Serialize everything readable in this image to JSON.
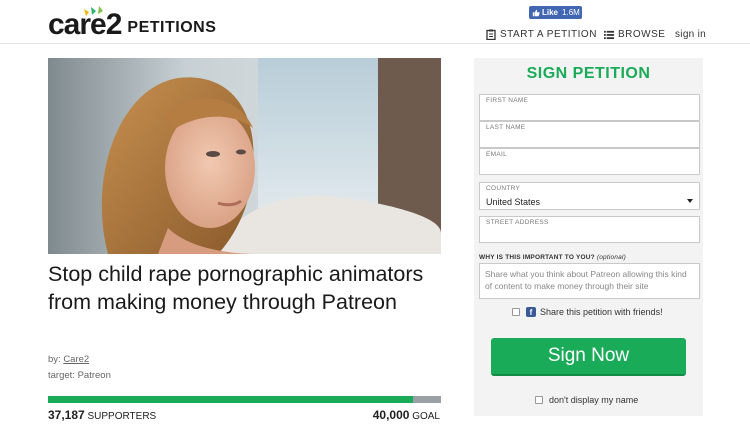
{
  "header": {
    "logo_main": "care2",
    "logo_sub": "PETITIONS",
    "fb_like_label": "Like",
    "fb_like_count": "1.6M",
    "nav": {
      "start_label": "START A PETITION",
      "browse_label": "BROWSE",
      "signin_label": "sign in"
    }
  },
  "petition": {
    "title": "Stop child rape pornographic animators from making money through Patreon",
    "by_prefix": "by: ",
    "author": "Care2",
    "target_prefix": "target: ",
    "target": "Patreon",
    "supporters_count": "37,187",
    "supporters_label": "SUPPORTERS",
    "goal_count": "40,000",
    "goal_label": "GOAL",
    "progress_fraction": 0.93
  },
  "form": {
    "title": "SIGN PETITION",
    "first_name_label": "FIRST NAME",
    "last_name_label": "LAST NAME",
    "email_label": "EMAIL",
    "country_label": "COUNTRY",
    "country_value": "United States",
    "street_label": "STREET ADDRESS",
    "why_label": "WHY IS THIS IMPORTANT TO YOU?",
    "why_optional": "(optional)",
    "why_placeholder": "Share what you think about Patreon allowing this kind of content to make money through their site",
    "share_label": "Share this petition with friends!",
    "sign_button": "Sign Now",
    "hide_name_label": "don't display my name"
  },
  "colors": {
    "accent_green": "#1aab58",
    "facebook_blue": "#4267b2"
  }
}
